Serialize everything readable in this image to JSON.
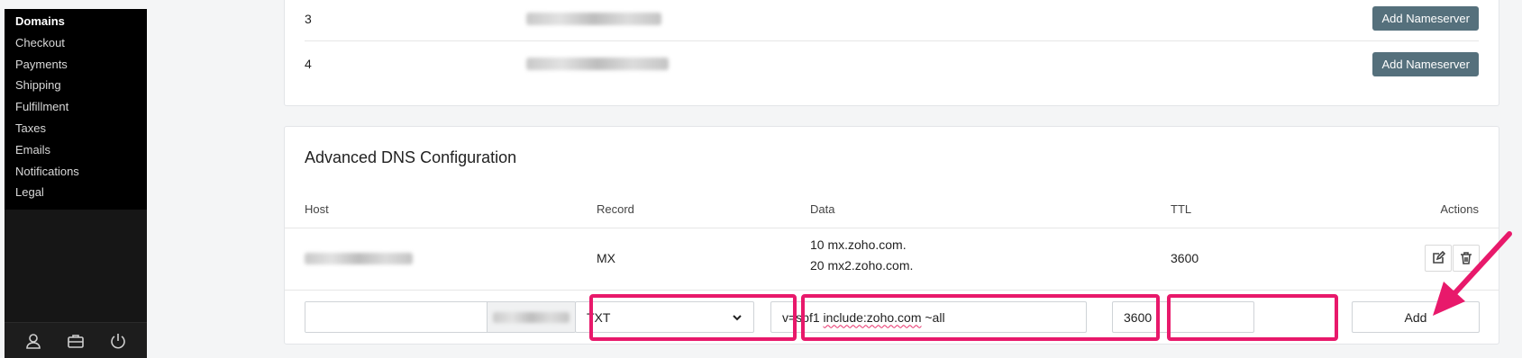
{
  "sidebar": {
    "items": [
      {
        "label": "Domains",
        "active": true
      },
      {
        "label": "Checkout"
      },
      {
        "label": "Payments"
      },
      {
        "label": "Shipping"
      },
      {
        "label": "Fulfillment"
      },
      {
        "label": "Taxes"
      },
      {
        "label": "Emails"
      },
      {
        "label": "Notifications"
      },
      {
        "label": "Legal"
      }
    ],
    "footer_icons": [
      "user-icon",
      "briefcase-icon",
      "power-icon"
    ]
  },
  "nameservers": {
    "rows": [
      {
        "number": "3",
        "button_label": "Add Nameserver"
      },
      {
        "number": "4",
        "button_label": "Add Nameserver"
      }
    ]
  },
  "dns": {
    "title": "Advanced DNS Configuration",
    "headers": {
      "host": "Host",
      "record": "Record",
      "data": "Data",
      "ttl": "TTL",
      "actions": "Actions"
    },
    "existing_row": {
      "record": "MX",
      "data": [
        "10 mx.zoho.com.",
        "20 mx2.zoho.com."
      ],
      "ttl": "3600",
      "action_icons": [
        "edit-icon",
        "trash-icon"
      ]
    },
    "new_row": {
      "host_value": "",
      "record_value": "TXT",
      "data_value_parts": [
        "v=spf1 ",
        "include:zoho.com",
        " ~all"
      ],
      "ttl_value": "3600",
      "add_label": "Add"
    }
  },
  "colors": {
    "highlight": "#e8196b",
    "nameserver_button": "#55707c",
    "sidebar_bg": "#000000"
  }
}
